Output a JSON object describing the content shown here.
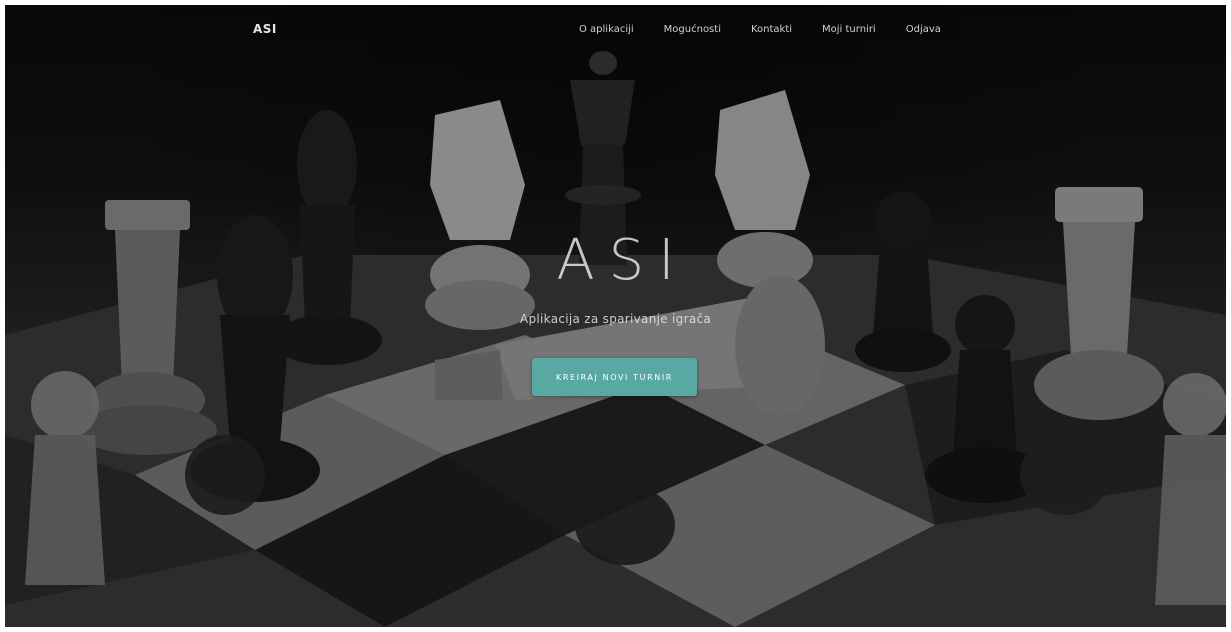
{
  "nav": {
    "brand": "ASI",
    "links": [
      "O aplikaciji",
      "Mogućnosti",
      "Kontakti",
      "Moji turniri",
      "Odjava"
    ]
  },
  "hero": {
    "title": "ASI",
    "subtitle": "Aplikacija za sparivanje igrača",
    "cta_label": "KREIRAJ NOVI TURNIR",
    "background_image": "chess-pieces-on-board"
  },
  "colors": {
    "accent": "#5aa8a3",
    "overlay": "#1a1a1a",
    "nav_text": "#d0d0d0"
  }
}
